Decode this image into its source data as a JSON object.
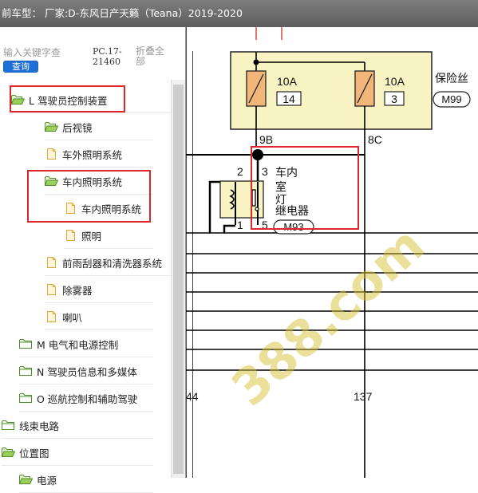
{
  "window": {
    "title": "前车型：  厂家:D-东风日产天籁（Teana）2019-2020"
  },
  "search": {
    "placeholder": "输入关键字查",
    "button": "查询",
    "code": "PC.17-21460",
    "collapse": "折叠全部"
  },
  "tree": [
    {
      "label": "L 驾驶员控制装置",
      "icon": "folder-open-icon"
    },
    {
      "label": "后视镜",
      "icon": "folder-open-icon"
    },
    {
      "label": "车外照明系统",
      "icon": "document-icon"
    },
    {
      "label": "车内照明系统",
      "icon": "folder-open-icon"
    },
    {
      "label": "车内照明系统",
      "icon": "document-icon"
    },
    {
      "label": "照明",
      "icon": "document-icon"
    },
    {
      "label": "前雨刮器和清洗器系统",
      "icon": "document-icon"
    },
    {
      "label": "除雾器",
      "icon": "document-icon"
    },
    {
      "label": "喇叭",
      "icon": "document-icon"
    },
    {
      "label": "M 电气和电源控制",
      "icon": "folder-closed-icon"
    },
    {
      "label": "N 驾驶员信息和多媒体",
      "icon": "folder-closed-icon"
    },
    {
      "label": "O 巡航控制和辅助驾驶",
      "icon": "folder-closed-icon"
    },
    {
      "label": "线束电路",
      "icon": "folder-closed-icon"
    },
    {
      "label": "位置图",
      "icon": "folder-open-icon"
    },
    {
      "label": "电源",
      "icon": "folder-open-icon"
    }
  ],
  "diagram": {
    "fuse1": {
      "rating": "10A",
      "number": "14"
    },
    "fuse2": {
      "rating": "10A",
      "number": "3"
    },
    "fuse_box_label": "保险丝",
    "fuse_box_connector": "M99",
    "wire_9b": "9B",
    "wire_8c": "8C",
    "relay_pins": {
      "p2": "2",
      "p3": "3",
      "p1": "1",
      "p5": "5"
    },
    "relay_name": [
      "车内",
      "室",
      "灯",
      "继电器"
    ],
    "relay_connector": "M93",
    "bottom_left": "44",
    "bottom_right": "137",
    "watermark": "388.com"
  },
  "colors": {
    "wire": "#000000",
    "fuse_box_fill": "#f8f3c3",
    "highlight": "#e0262d",
    "watermark": "#c9b324",
    "title_bar": "#6e6e6e",
    "query_button": "#1e70d8"
  }
}
